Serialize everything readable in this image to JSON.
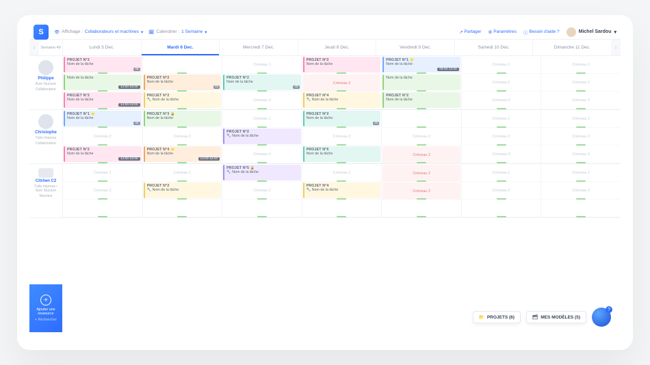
{
  "topbar": {
    "display_label": "Affichage :",
    "display_value": "Collaborateurs et machines",
    "calendar_label": "Calendrier :",
    "calendar_value": "1 Semaine",
    "share": "Partager",
    "settings": "Paramètres",
    "help": "Besoin d'aide ?",
    "user_name": "Michel Sardou"
  },
  "week_label": "Semaine 49",
  "days": [
    {
      "label": "Lundi 5 Dec.",
      "active": false
    },
    {
      "label": "Mardi 6 Dec.",
      "active": true
    },
    {
      "label": "Mercredi 7 Dec.",
      "active": false
    },
    {
      "label": "Jeudi 8 Dec.",
      "active": false
    },
    {
      "label": "Vendredi 9 Dec.",
      "active": false
    },
    {
      "label": "Samedi 10 Dec.",
      "active": false
    },
    {
      "label": "Dimanche 11 Dec.",
      "active": false
    }
  ],
  "resources": [
    {
      "name": "Philippe",
      "sub1": "Auto Stucture",
      "sub2": "Collaborateur",
      "avatar": "person",
      "rows": [
        [
          {
            "type": "task",
            "color": "c-pink",
            "pn": "PROJET N°2",
            "tn": "Nom de la tâche",
            "badge": "45"
          },
          {
            "type": "empty"
          },
          {
            "type": "creneau",
            "label": "Créneau 1"
          },
          {
            "type": "task",
            "color": "c-pink",
            "pn": "PROJET N°2",
            "tn": "Nom de la tâche"
          },
          {
            "type": "task",
            "color": "c-blue",
            "pn": "PROJET N°1 ⭐",
            "tn": "Nom de la tâche",
            "time": "09:00-12:00"
          },
          {
            "type": "creneau",
            "label": "Créneau 1"
          },
          {
            "type": "creneau",
            "label": "Créneau 1"
          }
        ],
        [
          {
            "type": "task",
            "color": "c-green",
            "pn": "",
            "tn": "Nom de la tâche",
            "time": "14:00-18:00"
          },
          {
            "type": "task",
            "color": "c-orange",
            "pn": "PROJET N°2",
            "tn": "Nom de la tâche",
            "badge": "45"
          },
          {
            "type": "task",
            "color": "c-teal",
            "pn": "PROJET N°2",
            "tn": "Nom de la tâche",
            "badge": "45"
          },
          {
            "type": "cren-red",
            "label": "Créneau 2"
          },
          {
            "type": "task",
            "color": "c-green",
            "pn": "",
            "tn": "Nom de la tâche"
          },
          {
            "type": "creneau",
            "label": "Créneau 2"
          },
          {
            "type": "creneau",
            "label": "Créneau 2"
          }
        ],
        [
          {
            "type": "task",
            "color": "c-pink",
            "pn": "PROJET N°2",
            "tn": "Nom de la tâche",
            "time": "14:00-18:00"
          },
          {
            "type": "task",
            "color": "c-yellow",
            "pn": "PROJET N°2",
            "tn": "🔧 Nom de la tâche"
          },
          {
            "type": "creneau",
            "label": "Créneau 3"
          },
          {
            "type": "task",
            "color": "c-yellow",
            "pn": "PROJET N°4",
            "tn": "🔧 Nom de la tâche"
          },
          {
            "type": "task",
            "color": "c-green",
            "pn": "PROJET N°2",
            "tn": "Nom de la tâche"
          },
          {
            "type": "creneau",
            "label": "Créneau 3"
          },
          {
            "type": "creneau",
            "label": "Créneau 3"
          }
        ]
      ]
    },
    {
      "name": "Christophe",
      "sub1": "Tutto Impresa",
      "sub2": "Collaborateur",
      "avatar": "person",
      "rows": [
        [
          {
            "type": "task",
            "color": "c-blue",
            "pn": "PROJET N°1 ⭐",
            "tn": "Nom de la tâche",
            "badge": "45"
          },
          {
            "type": "task",
            "color": "c-green",
            "pn": "PROJET N°3 🔒",
            "tn": "Nom de la tâche"
          },
          {
            "type": "creneau",
            "label": "Créneau 1"
          },
          {
            "type": "task",
            "color": "c-teal",
            "pn": "PROJET N°2",
            "tn": "Nom de la tâche",
            "badge": "45"
          },
          {
            "type": "empty"
          },
          {
            "type": "creneau",
            "label": "Créneau 1"
          },
          {
            "type": "creneau",
            "label": "Créneau 1"
          }
        ],
        [
          {
            "type": "creneau",
            "label": "Créneau 2"
          },
          {
            "type": "creneau",
            "label": "Créneau 2"
          },
          {
            "type": "task",
            "color": "c-purple",
            "pn": "PROJET N°2",
            "tn": "🔧 Nom de la tâche"
          },
          {
            "type": "creneau",
            "label": "Créneau 2"
          },
          {
            "type": "creneau",
            "label": "Créneau 2"
          },
          {
            "type": "creneau",
            "label": "Créneau 2"
          },
          {
            "type": "creneau",
            "label": "Créneau 2"
          }
        ],
        [
          {
            "type": "task",
            "color": "c-pink",
            "pn": "PROJET N°2",
            "tn": "Nom de la tâche",
            "time": "14:00-18:00"
          },
          {
            "type": "task",
            "color": "c-orange",
            "pn": "PROJET N°4 ⭐",
            "tn": "Nom de la tâche",
            "time": "14:00-18:00"
          },
          {
            "type": "creneau",
            "label": "Créneau 3"
          },
          {
            "type": "task",
            "color": "c-teal",
            "pn": "PROJET N°5",
            "tn": "Nom de la tâche"
          },
          {
            "type": "cren-red",
            "label": "Créneau 2"
          },
          {
            "type": "creneau",
            "label": "Créneau 3"
          },
          {
            "type": "creneau",
            "label": "Créneau 3"
          }
        ]
      ]
    },
    {
      "name": "Citröen C2",
      "sub1": "Tutto Impresa • Auto Stucture",
      "sub2": "Machine",
      "avatar": "car",
      "rows": [
        [
          {
            "type": "creneau",
            "label": "Créneau 1"
          },
          {
            "type": "creneau",
            "label": "Créneau 1"
          },
          {
            "type": "task",
            "color": "c-purple",
            "pn": "PROJET N°5 🔒",
            "tn": "🔧 Nom de la tâche"
          },
          {
            "type": "creneau",
            "label": "Créneau 1"
          },
          {
            "type": "cren-red",
            "label": "Créneau 2"
          },
          {
            "type": "creneau",
            "label": "Créneau 1"
          },
          {
            "type": "creneau",
            "label": "Créneau 1"
          }
        ],
        [
          {
            "type": "creneau",
            "label": "Créneau 2"
          },
          {
            "type": "task",
            "color": "c-yellow",
            "pn": "PROJET N°2",
            "tn": "🔧 Nom de la tâche"
          },
          {
            "type": "creneau",
            "label": "Créneau 2"
          },
          {
            "type": "task",
            "color": "c-yellow",
            "pn": "PROJET N°4",
            "tn": "🔧 Nom de la tâche"
          },
          {
            "type": "cren-red",
            "label": "Créneau 2"
          },
          {
            "type": "creneau",
            "label": "Créneau 2"
          },
          {
            "type": "creneau",
            "label": "Créneau 2"
          }
        ],
        [
          {
            "type": "creneau",
            "label": ""
          },
          {
            "type": "creneau",
            "label": ""
          },
          {
            "type": "creneau",
            "label": ""
          },
          {
            "type": "creneau",
            "label": ""
          },
          {
            "type": "creneau",
            "label": ""
          },
          {
            "type": "creneau",
            "label": ""
          },
          {
            "type": "creneau",
            "label": ""
          }
        ]
      ]
    }
  ],
  "add_resource": {
    "line1": "Ajouter une",
    "line2": "ressource",
    "line3": "+ Rechercher"
  },
  "footer": {
    "projects": "PROJETS (6)",
    "models": "MES MODÈLES (5)"
  }
}
